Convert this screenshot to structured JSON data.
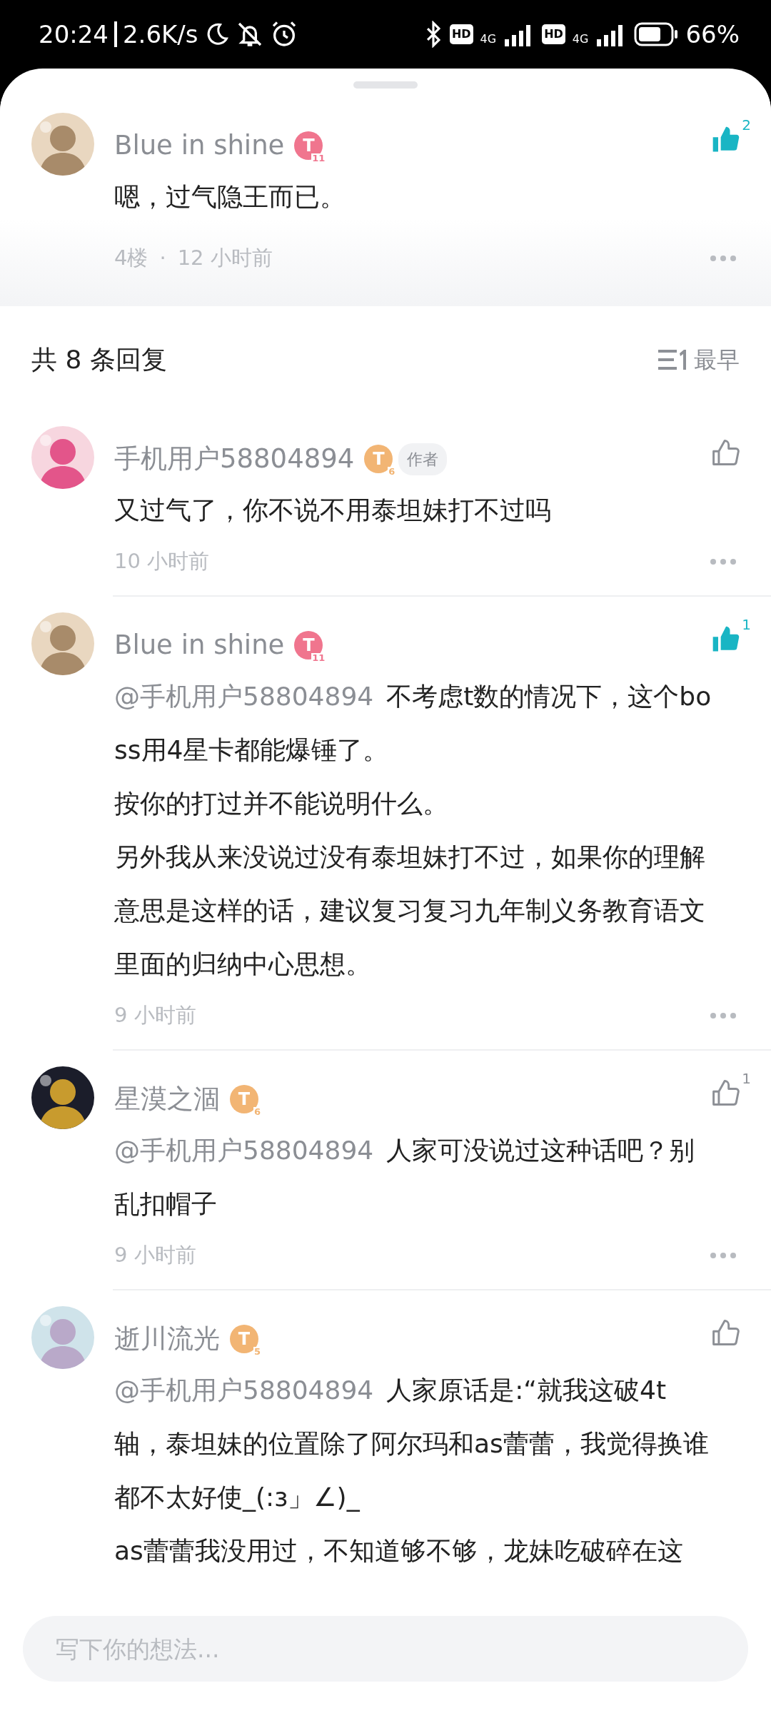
{
  "status_bar": {
    "time": "20:24",
    "speed": "2.6K/s",
    "sims": [
      {
        "hd": "HD",
        "network": "4G"
      },
      {
        "hd": "HD",
        "network": "4G"
      }
    ],
    "battery": "66%"
  },
  "main_comment": {
    "user": "Blue in shine",
    "badge": {
      "kind": "triangle",
      "letter": "T",
      "level": "11"
    },
    "text": "嗯，过气隐王而已。",
    "floor": "4楼",
    "separator": "·",
    "time": "12 小时前",
    "likes": "2",
    "liked": true
  },
  "replies_header": {
    "title": "共 8 条回复",
    "sort": "最早"
  },
  "replies": [
    {
      "user": "手机用户58804894",
      "badge": {
        "kind": "coin",
        "letter": "T",
        "level": "6"
      },
      "tag": "作者",
      "paragraphs": [
        "又过气了，你不说不用泰坦妹打不过吗"
      ],
      "time": "10 小时前",
      "liked": false
    },
    {
      "user": "Blue in shine",
      "badge": {
        "kind": "triangle",
        "letter": "T",
        "level": "11"
      },
      "mention": "@手机用户58804894",
      "paragraphs": [
        "不考虑t数的情况下，这个boss用4星卡都能爆锤了。",
        "按你的打过并不能说明什么。",
        "另外我从来没说过没有泰坦妹打不过，如果你的理解意思是这样的话，建议复习复习九年制义务教育语文里面的归纳中心思想。"
      ],
      "time": "9 小时前",
      "likes": "1",
      "liked": true
    },
    {
      "user": "星漠之涸",
      "badge": {
        "kind": "coin",
        "letter": "T",
        "level": "6"
      },
      "mention": "@手机用户58804894",
      "paragraphs": [
        "人家可没说过这种话吧？别乱扣帽子"
      ],
      "time": "9 小时前",
      "likes": "1",
      "liked": false
    },
    {
      "user": "逝川流光",
      "badge": {
        "kind": "coin",
        "letter": "T",
        "level": "5"
      },
      "mention": "@手机用户58804894",
      "paragraphs": [
        "人家原话是:“就我这破4t轴，泰坦妹的位置除了阿尔玛和as蕾蕾，我觉得换谁都不太好使_(:з」∠)_",
        "as蕾蕾我没用过，不知道够不够，龙妹吃破碎在这"
      ],
      "liked": false
    }
  ],
  "composer": {
    "placeholder": "写下你的想法..."
  }
}
